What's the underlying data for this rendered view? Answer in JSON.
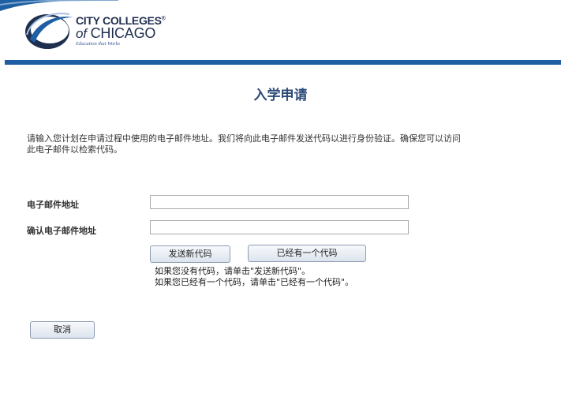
{
  "brand": {
    "line1": "CITY COLLEGES",
    "line1_mark": "®",
    "line2_of": "of",
    "line2_name": "CHICAGO",
    "tagline": "Education that Works",
    "colors": {
      "navy": "#1f2f4f",
      "blue_bar": "#1e5fa3",
      "title": "#2c4a78"
    }
  },
  "page": {
    "title": "入学申请",
    "instructions": "请输入您计划在申请过程中使用的电子邮件地址。我们将向此电子邮件发送代码以进行身份验证。确保您可以访问此电子邮件以检索代码。"
  },
  "form": {
    "email_label": "电子邮件地址",
    "email_value": "",
    "confirm_email_label": "确认电子邮件地址",
    "confirm_email_value": ""
  },
  "actions": {
    "send_new_code": "发送新代码",
    "have_code": "已经有一个代码",
    "cancel": "取消"
  },
  "help": {
    "line1": "如果您没有代码，请单击\"发送新代码\"。",
    "line2": "如果您已经有一个代码，请单击\"已经有一个代码\"。"
  }
}
